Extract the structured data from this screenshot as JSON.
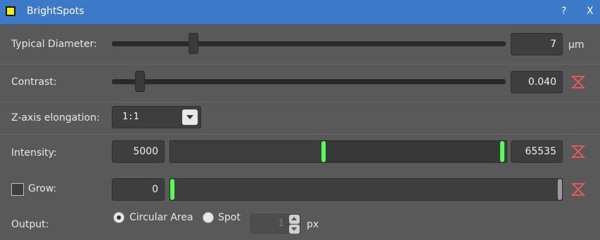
{
  "window": {
    "title": "BrightSpots",
    "help_label": "?",
    "close_label": "X",
    "icon_color": "#f0f000"
  },
  "typical_diameter": {
    "label": "Typical Diameter:",
    "value": "7",
    "unit": "µm",
    "slider_fraction": 0.2
  },
  "contrast": {
    "label": "Contrast:",
    "value": "0.040",
    "slider_fraction": 0.06,
    "reset_icon": "hourglass-reset-icon"
  },
  "z_axis": {
    "label": "Z-axis elongation:",
    "selected": "1:1"
  },
  "intensity": {
    "label": "Intensity:",
    "min_value": "5000",
    "max_value": "65535",
    "reset_icon": "hourglass-reset-icon"
  },
  "grow": {
    "label": "Grow:",
    "checked": false,
    "value": "0",
    "reset_icon": "hourglass-reset-icon"
  },
  "output": {
    "label": "Output:",
    "options": [
      "Circular Area",
      "Spot"
    ],
    "selected": "Circular Area",
    "spot_size": "1",
    "spot_unit": "px"
  },
  "colors": {
    "accent_green": "#55ff55",
    "reset_red": "#e05a5a",
    "titlebar_blue": "#3d79c9"
  }
}
